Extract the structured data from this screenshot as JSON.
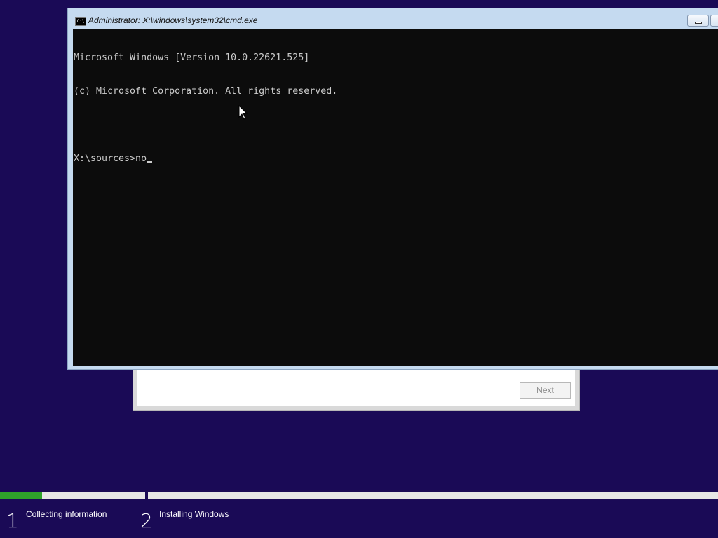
{
  "cmd_window": {
    "title": "Administrator: X:\\windows\\system32\\cmd.exe",
    "icon": "cmd-icon",
    "icon_text": "C:\\",
    "console_lines": [
      "Microsoft Windows [Version 10.0.22621.525]",
      "(c) Microsoft Corporation. All rights reserved.",
      "",
      "X:\\sources>no"
    ],
    "colors": {
      "console_background": "#0c0c0c",
      "console_text": "#cccccc",
      "frame": "#c5daf0"
    }
  },
  "setup_dialog": {
    "next_label": "Next"
  },
  "progress": {
    "fill_fraction": 0.29,
    "fill_color": "#2fa32a",
    "steps": [
      {
        "number": "1",
        "label": "Collecting information"
      },
      {
        "number": "2",
        "label": "Installing Windows"
      }
    ]
  },
  "background_color": "#1a0a56",
  "mouse_pointer_icon": "arrow-pointer-icon"
}
